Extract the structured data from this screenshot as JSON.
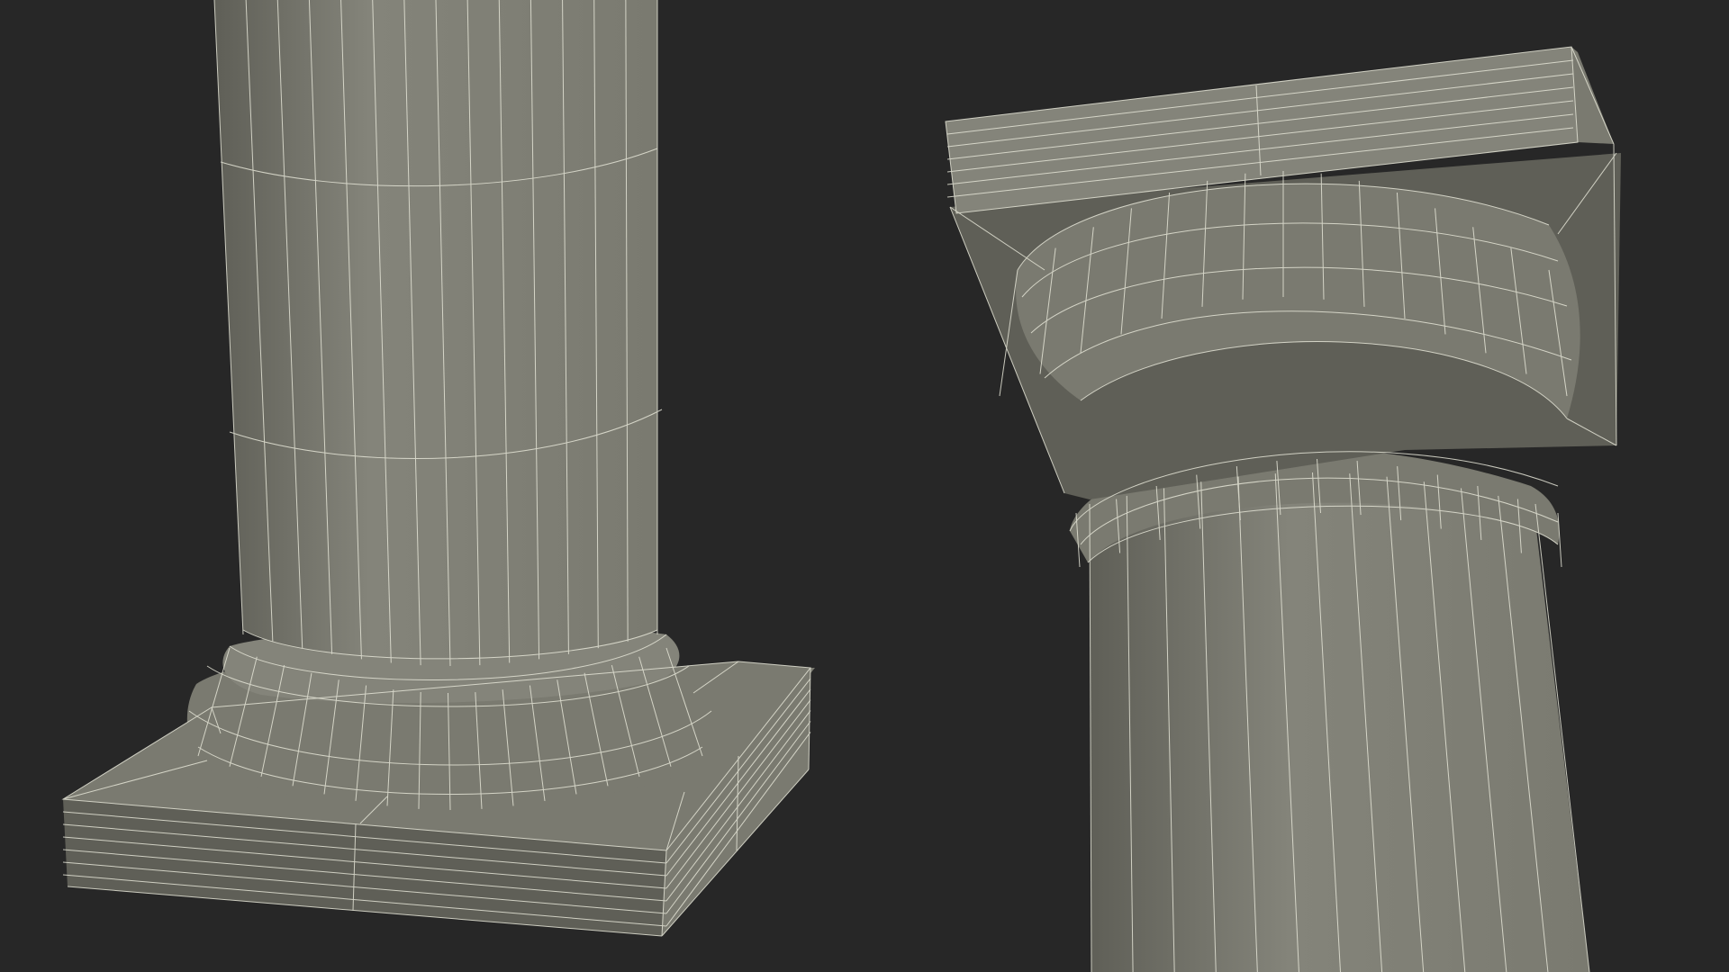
{
  "colors": {
    "background": "#272727",
    "surface": "#7a7a70",
    "surface_light": "#84847a",
    "surface_dark": "#5f5f57",
    "wire": "#e4e4d6"
  },
  "views": [
    {
      "name": "column-base-wireframe-view"
    },
    {
      "name": "column-capital-wireframe-view"
    }
  ]
}
